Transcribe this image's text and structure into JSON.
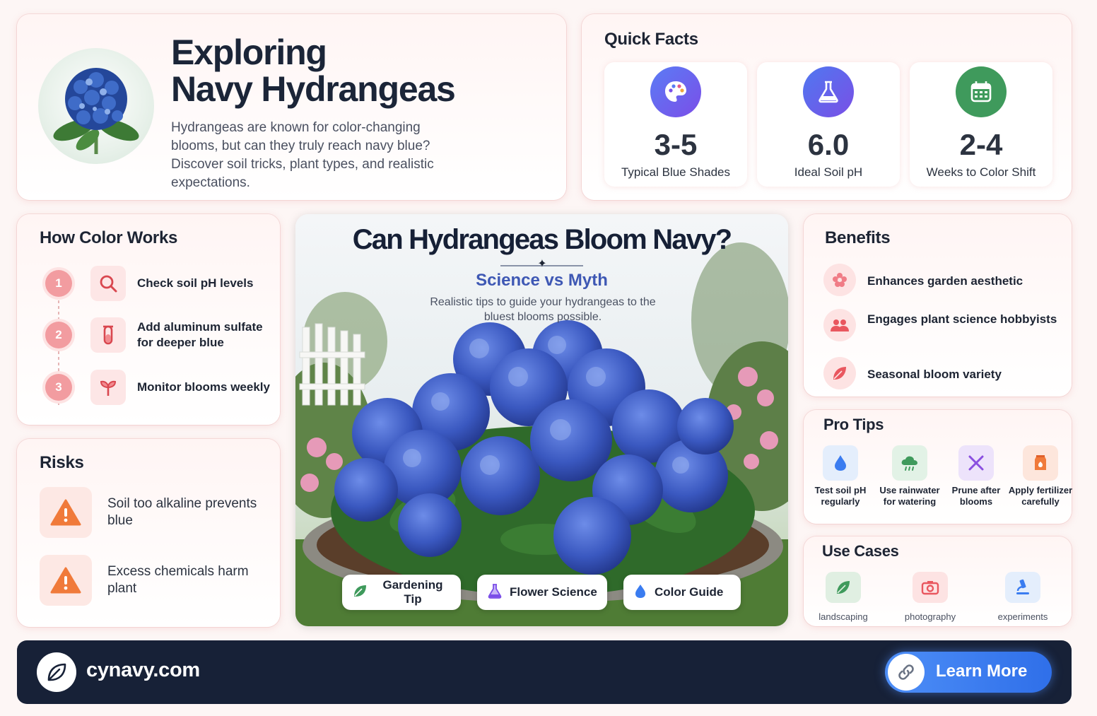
{
  "hero": {
    "title_line1": "Exploring",
    "title_line2": "Navy Hydrangeas",
    "description": "Hydrangeas are known for color-changing blooms, but can they truly reach navy blue? Discover soil tricks, plant types, and realistic expectations.",
    "image_icon": "hydrangea-flower-icon"
  },
  "quick_facts": {
    "title": "Quick Facts",
    "items": [
      {
        "value": "3-5",
        "label": "Typical Blue Shades",
        "icon": "palette-icon",
        "color": "#6b5cf0"
      },
      {
        "value": "6.0",
        "label": "Ideal Soil pH",
        "icon": "flask-icon",
        "color": "#5b6ef0"
      },
      {
        "value": "2-4",
        "label": "Weeks to Color Shift",
        "icon": "calendar-icon",
        "color": "#3f9a5c"
      }
    ]
  },
  "how_color_works": {
    "title": "How Color Works",
    "steps": [
      {
        "number": "1",
        "label": "Check soil pH levels",
        "icon": "search-icon"
      },
      {
        "number": "2",
        "label": "Add aluminum sulfate for deeper blue",
        "icon": "test-tube-icon"
      },
      {
        "number": "3",
        "label": "Monitor blooms weekly",
        "icon": "sprout-icon"
      }
    ]
  },
  "risks": {
    "title": "Risks",
    "items": [
      {
        "label": "Soil too alkaline prevents blue",
        "icon": "warning-icon"
      },
      {
        "label": "Excess chemicals harm plant",
        "icon": "warning-icon"
      }
    ],
    "accent_color": "#f07a3a"
  },
  "feature": {
    "title": "Can Hydrangeas Bloom Navy?",
    "subtitle": "Science vs Myth",
    "description": "Realistic tips to guide your hydrangeas to the bluest blooms possible.",
    "pills": [
      {
        "label": "Gardening Tip",
        "icon": "leaf-icon"
      },
      {
        "label": "Flower Science",
        "icon": "flask-icon"
      },
      {
        "label": "Color Guide",
        "icon": "droplet-icon"
      }
    ]
  },
  "benefits": {
    "title": "Benefits",
    "items": [
      {
        "label": "Enhances garden aesthetic",
        "icon": "flower-icon"
      },
      {
        "label": "Engages plant science hobbyists",
        "icon": "people-icon"
      },
      {
        "label": "Seasonal bloom variety",
        "icon": "leaf-icon"
      }
    ]
  },
  "pro_tips": {
    "title": "Pro Tips",
    "items": [
      {
        "label": "Test soil pH regularly",
        "icon": "droplet-icon"
      },
      {
        "label": "Use rainwater for watering",
        "icon": "rain-cloud-icon"
      },
      {
        "label": "Prune after blooms",
        "icon": "scissors-icon"
      },
      {
        "label": "Apply fertilizer carefully",
        "icon": "fertilizer-bag-icon"
      }
    ]
  },
  "use_cases": {
    "title": "Use Cases",
    "items": [
      {
        "label": "landscaping",
        "icon": "leaf-icon"
      },
      {
        "label": "photography",
        "icon": "camera-icon"
      },
      {
        "label": "experiments",
        "icon": "microscope-icon"
      }
    ]
  },
  "footer": {
    "site": "cynavy.com",
    "logo_icon": "leaf-icon",
    "cta_label": "Learn More",
    "cta_icon": "link-icon",
    "background": "#172137",
    "cta_color": "#3a7cf0"
  }
}
